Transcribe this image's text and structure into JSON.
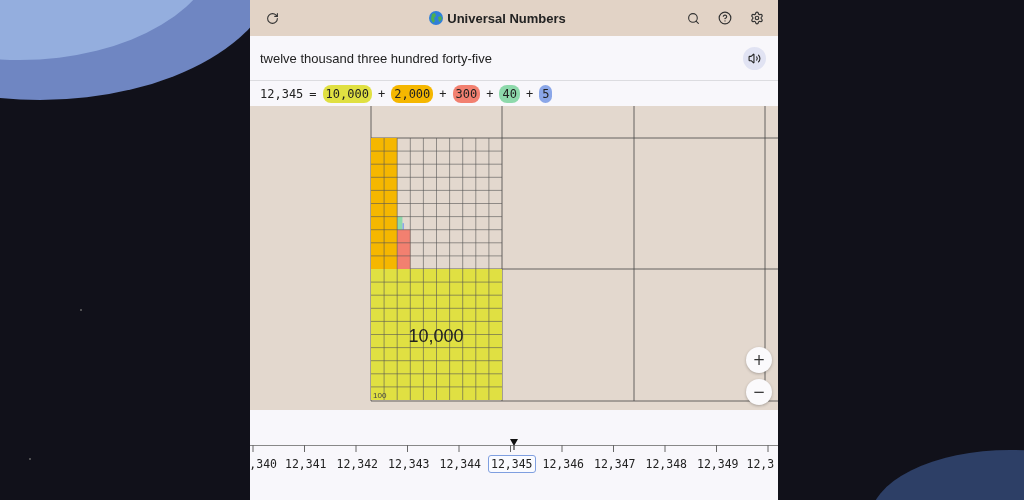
{
  "header": {
    "title": "Universal Numbers"
  },
  "words": "twelve thousand three hundred forty-five",
  "equation": [
    {
      "kind": "number",
      "text": "12,345"
    },
    {
      "kind": "op",
      "text": "="
    },
    {
      "kind": "term",
      "text": "10,000",
      "color": "#e0e042"
    },
    {
      "kind": "op",
      "text": "+"
    },
    {
      "kind": "term",
      "text": "2,000",
      "color": "#f5b700"
    },
    {
      "kind": "op",
      "text": "+"
    },
    {
      "kind": "term",
      "text": "300",
      "color": "#f28070"
    },
    {
      "kind": "op",
      "text": "+"
    },
    {
      "kind": "term",
      "text": "40",
      "color": "#8dd9ab"
    },
    {
      "kind": "op",
      "text": "+"
    },
    {
      "kind": "term",
      "text": "5",
      "color": "#8aa6e8"
    }
  ],
  "canvas": {
    "big_label": "10,000",
    "corner_label": "100"
  },
  "zoom_buttons": [
    "+",
    "−"
  ],
  "number_line": [
    {
      "text": ",340",
      "selected": false
    },
    {
      "text": "12,341",
      "selected": false
    },
    {
      "text": "12,342",
      "selected": false
    },
    {
      "text": "12,343",
      "selected": false
    },
    {
      "text": "12,344",
      "selected": false
    },
    {
      "text": "12,345",
      "selected": true
    },
    {
      "text": "12,346",
      "selected": false
    },
    {
      "text": "12,347",
      "selected": false
    },
    {
      "text": "12,348",
      "selected": false
    },
    {
      "text": "12,349",
      "selected": false
    },
    {
      "text": "12,3",
      "selected": false
    }
  ]
}
